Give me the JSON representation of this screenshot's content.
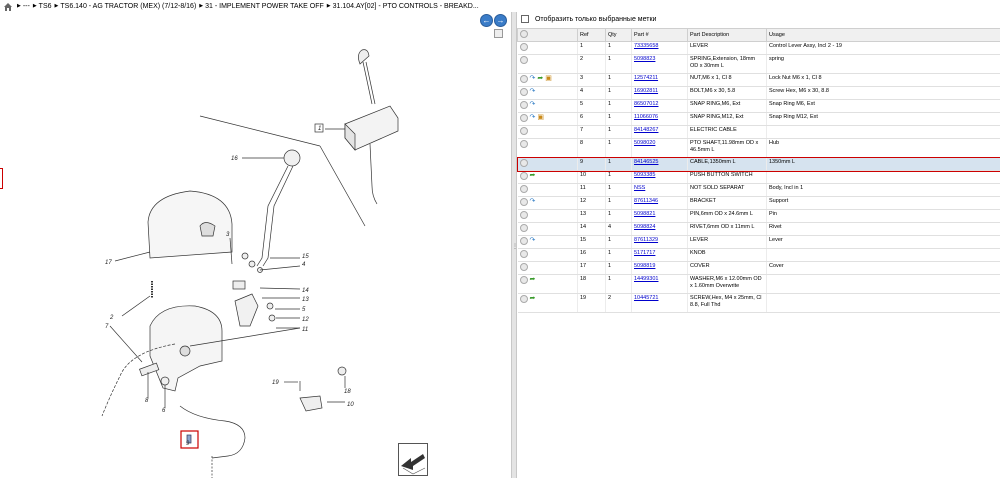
{
  "breadcrumb": {
    "items": [
      "---",
      "TS6",
      "TS6.140 - AG TRACTOR (MEX) (7/12-8/16)",
      "31 - IMPLEMENT POWER TAKE OFF",
      "31.104.AY[02] - PTO CONTROLS - BREAKD..."
    ]
  },
  "nav": {
    "back": "←",
    "forward": "→"
  },
  "filter": {
    "label": "Отобразить только выбранные метки"
  },
  "table": {
    "columns": [
      "",
      "Ref",
      "Qty",
      "Part #",
      "Part Description",
      "Usage"
    ],
    "rows": [
      {
        "icons": [],
        "ref": "1",
        "qty": "1",
        "part": "73335658",
        "desc": "LEVER",
        "usage": "Control Lever Assy, Incl 2 - 19",
        "tall": false
      },
      {
        "icons": [],
        "ref": "2",
        "qty": "1",
        "part": "5098823",
        "desc": "SPRING,Extension, 18mm OD x 30mm L",
        "usage": "spring",
        "tall": true
      },
      {
        "icons": [
          "blue",
          "green",
          "pkg"
        ],
        "ref": "3",
        "qty": "1",
        "part": "12574211",
        "desc": "NUT,M6 x 1, Cl 8",
        "usage": "Lock Nut M6 x 1, Cl 8",
        "tall": false
      },
      {
        "icons": [
          "blue"
        ],
        "ref": "4",
        "qty": "1",
        "part": "16902811",
        "desc": "BOLT,M6 x 30, 5.8",
        "usage": "Screw Hex, M6 x 30, 8.8",
        "tall": false
      },
      {
        "icons": [
          "blue"
        ],
        "ref": "5",
        "qty": "1",
        "part": "86507012",
        "desc": "SNAP RING,M6, Ext",
        "usage": "Snap Ring M6, Ext",
        "tall": false
      },
      {
        "icons": [
          "blue",
          "pkg"
        ],
        "ref": "6",
        "qty": "1",
        "part": "11066076",
        "desc": "SNAP RING,M12, Ext",
        "usage": "Snap Ring M12, Ext",
        "tall": false
      },
      {
        "icons": [],
        "ref": "7",
        "qty": "1",
        "part": "84148267",
        "desc": "ELECTRIC CABLE",
        "usage": "",
        "tall": false
      },
      {
        "icons": [],
        "ref": "8",
        "qty": "1",
        "part": "5098020",
        "desc": "PTO SHAFT,11.98mm OD x 46.5mm L",
        "usage": "Hub",
        "tall": true
      },
      {
        "icons": [],
        "ref": "9",
        "qty": "1",
        "part": "84146525",
        "desc": "CABLE,1350mm L",
        "usage": "1350mm L",
        "tall": false,
        "selected": true
      },
      {
        "icons": [
          "green"
        ],
        "ref": "10",
        "qty": "1",
        "part": "5093385",
        "desc": "PUSH BUTTON SWITCH",
        "usage": "",
        "tall": false
      },
      {
        "icons": [],
        "ref": "11",
        "qty": "1",
        "part": "NSS",
        "desc": "NOT SOLD SEPARAT",
        "usage": "Body, Incl in 1",
        "tall": false
      },
      {
        "icons": [
          "blue"
        ],
        "ref": "12",
        "qty": "1",
        "part": "87611346",
        "desc": "BRACKET",
        "usage": "Support",
        "tall": false
      },
      {
        "icons": [],
        "ref": "13",
        "qty": "1",
        "part": "5098821",
        "desc": "PIN,6mm OD x 24.6mm L",
        "usage": "Pin",
        "tall": false
      },
      {
        "icons": [],
        "ref": "14",
        "qty": "4",
        "part": "5098824",
        "desc": "RIVET,6mm OD x 11mm L",
        "usage": "Rivet",
        "tall": false
      },
      {
        "icons": [
          "blue"
        ],
        "ref": "15",
        "qty": "1",
        "part": "87611329",
        "desc": "LEVER",
        "usage": "Lever",
        "tall": false
      },
      {
        "icons": [],
        "ref": "16",
        "qty": "1",
        "part": "5171717",
        "desc": "KNOB",
        "usage": "",
        "tall": false
      },
      {
        "icons": [],
        "ref": "17",
        "qty": "1",
        "part": "5098819",
        "desc": "COVER",
        "usage": "Cover",
        "tall": false
      },
      {
        "icons": [
          "green"
        ],
        "ref": "18",
        "qty": "1",
        "part": "14499301",
        "desc": "WASHER,M6 x 12.00mm OD x 1.60mm    Overwrite",
        "usage": "",
        "tall": true
      },
      {
        "icons": [
          "green"
        ],
        "ref": "19",
        "qty": "2",
        "part": "10445721",
        "desc": "SCREW,Hex, M4 x 25mm, Cl 8.8, Full Thd",
        "usage": "",
        "tall": true
      }
    ]
  },
  "diagram": {
    "callouts": [
      "1",
      "2",
      "3",
      "4",
      "5",
      "6",
      "7",
      "8",
      "9",
      "10",
      "11",
      "12",
      "13",
      "14",
      "15",
      "16",
      "17",
      "18",
      "19"
    ]
  }
}
